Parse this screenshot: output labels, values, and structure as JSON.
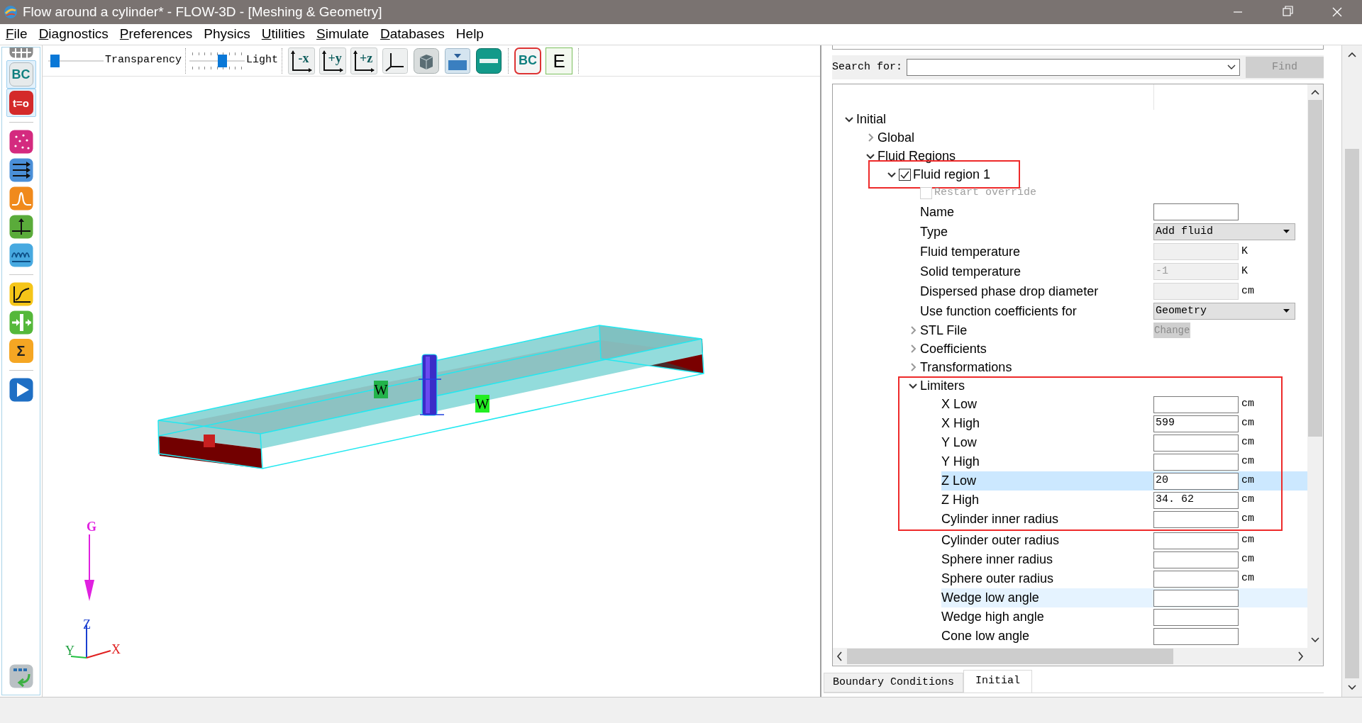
{
  "window": {
    "title": "Flow around a cylinder* - FLOW-3D - [Meshing & Geometry]"
  },
  "menu": [
    {
      "label": "File",
      "underline_first": true
    },
    {
      "label": "Diagnostics",
      "underline_first": true
    },
    {
      "label": "Preferences",
      "underline_first": true
    },
    {
      "label": "Physics",
      "underline_first": false
    },
    {
      "label": "Utilities",
      "underline_first": true
    },
    {
      "label": "Simulate",
      "underline_first": true
    },
    {
      "label": "Databases",
      "underline_first": true
    },
    {
      "label": "Help",
      "underline_first": false
    }
  ],
  "toolbar": {
    "sliders": [
      {
        "label": "Transparency",
        "level": 0.05,
        "ticks": false
      },
      {
        "label": "Light",
        "level": 0.62,
        "ticks": true
      }
    ],
    "button_groups": [
      [
        {
          "kind": "axis",
          "label": "-x"
        },
        {
          "kind": "axis",
          "label": "+y"
        },
        {
          "kind": "axis",
          "label": "+z"
        },
        {
          "kind": "triad"
        },
        {
          "kind": "solid"
        },
        {
          "kind": "water"
        },
        {
          "kind": "ruler"
        }
      ],
      [
        {
          "kind": "bc",
          "label": "BC"
        },
        {
          "kind": "sheet",
          "label": "E"
        }
      ]
    ]
  },
  "sidebar": {
    "groups": [
      [
        {
          "kind": "grid",
          "selected": false
        },
        {
          "kind": "bc",
          "label": "BC",
          "selected": true
        },
        {
          "kind": "init",
          "label": "t=o",
          "selected": true
        }
      ],
      [
        {
          "kind": "particles",
          "selected": false
        },
        {
          "kind": "arrows",
          "selected": false
        },
        {
          "kind": "wave",
          "selected": false
        },
        {
          "kind": "probe",
          "selected": false
        },
        {
          "kind": "spring",
          "selected": false
        }
      ],
      [
        {
          "kind": "graph",
          "selected": false
        },
        {
          "kind": "split",
          "selected": false
        },
        {
          "kind": "sigma",
          "label": "Σ",
          "selected": false
        }
      ],
      [
        {
          "kind": "play",
          "selected": false
        }
      ]
    ],
    "footer_item": {
      "kind": "exit"
    }
  },
  "viewport": {
    "boundary_labels": [
      "W",
      "W"
    ],
    "gravity_label": "G",
    "axis_labels": [
      "Z",
      "Y",
      "X"
    ]
  },
  "search": {
    "label": "Search for:",
    "button": "Find",
    "button_disabled": true
  },
  "tree": [
    {
      "kind": "group",
      "label": "Initial",
      "expanded": true,
      "children": [
        {
          "kind": "group",
          "label": "Global",
          "expanded": false
        },
        {
          "kind": "group",
          "label": "Fluid Regions",
          "expanded": true,
          "children": [
            {
              "kind": "group",
              "label": "Fluid region 1",
              "expanded": true,
              "checked": true,
              "boxed": true,
              "children": [
                {
                  "kind": "checkbox",
                  "label": "Restart override",
                  "checked": false,
                  "disabled": true
                },
                {
                  "kind": "field",
                  "label": "Name",
                  "disabled": false
                },
                {
                  "kind": "select",
                  "label": "Type",
                  "value": "Add fluid"
                },
                {
                  "kind": "field",
                  "label": "Fluid temperature",
                  "disabled": true,
                  "unit": "K"
                },
                {
                  "kind": "field",
                  "label": "Solid temperature",
                  "disabled": true,
                  "value": "-1",
                  "unit": "K"
                },
                {
                  "kind": "field",
                  "label": "Dispersed phase drop diameter",
                  "disabled": true,
                  "unit": "cm"
                },
                {
                  "kind": "select",
                  "label": "Use function coefficients for",
                  "value": "Geometry"
                },
                {
                  "kind": "group",
                  "label": "STL File",
                  "expanded": false,
                  "button": "Change"
                },
                {
                  "kind": "group",
                  "label": "Coefficients",
                  "expanded": false
                },
                {
                  "kind": "group",
                  "label": "Transformations",
                  "expanded": false
                },
                {
                  "kind": "group",
                  "label": "Limiters",
                  "expanded": true,
                  "boxed": true,
                  "children": [
                    {
                      "kind": "field",
                      "label": "X Low",
                      "disabled": false,
                      "unit": "cm",
                      "selected": false,
                      "hovered": false,
                      "in_box": true
                    },
                    {
                      "kind": "field",
                      "label": "X High",
                      "disabled": false,
                      "value": "599",
                      "unit": "cm",
                      "selected": false,
                      "hovered": false,
                      "in_box": true
                    },
                    {
                      "kind": "field",
                      "label": "Y Low",
                      "disabled": false,
                      "unit": "cm",
                      "selected": false,
                      "hovered": false,
                      "in_box": true
                    },
                    {
                      "kind": "field",
                      "label": "Y High",
                      "disabled": false,
                      "unit": "cm",
                      "selected": false,
                      "hovered": false,
                      "in_box": true
                    },
                    {
                      "kind": "field",
                      "label": "Z Low",
                      "disabled": false,
                      "value": "20",
                      "unit": "cm",
                      "selected": true,
                      "hovered": false,
                      "in_box": true
                    },
                    {
                      "kind": "field",
                      "label": "Z High",
                      "disabled": false,
                      "value": "34. 62",
                      "unit": "cm",
                      "selected": false,
                      "hovered": false,
                      "in_box": true
                    },
                    {
                      "kind": "field",
                      "label": "Cylinder inner radius",
                      "disabled": false,
                      "unit": "cm",
                      "selected": false,
                      "hovered": false,
                      "in_box": true
                    },
                    {
                      "kind": "field",
                      "label": "Cylinder outer radius",
                      "disabled": false,
                      "unit": "cm",
                      "selected": false,
                      "hovered": false,
                      "in_box": false
                    },
                    {
                      "kind": "field",
                      "label": "Sphere inner radius",
                      "disabled": false,
                      "unit": "cm",
                      "selected": false,
                      "hovered": false,
                      "in_box": false
                    },
                    {
                      "kind": "field",
                      "label": "Sphere outer radius",
                      "disabled": false,
                      "unit": "cm",
                      "selected": false,
                      "hovered": false,
                      "in_box": false
                    },
                    {
                      "kind": "field",
                      "label": "Wedge low angle",
                      "disabled": false,
                      "selected": false,
                      "hovered": true,
                      "in_box": false
                    },
                    {
                      "kind": "field",
                      "label": "Wedge high angle",
                      "disabled": false,
                      "selected": false,
                      "hovered": false,
                      "in_box": false
                    },
                    {
                      "kind": "field",
                      "label": "Cone low angle",
                      "disabled": false,
                      "selected": false,
                      "hovered": false,
                      "in_box": false
                    }
                  ]
                }
              ]
            }
          ]
        }
      ]
    }
  ],
  "tabs": [
    {
      "label": "Boundary Conditions",
      "selected": false
    },
    {
      "label": "Initial",
      "selected": true
    }
  ]
}
